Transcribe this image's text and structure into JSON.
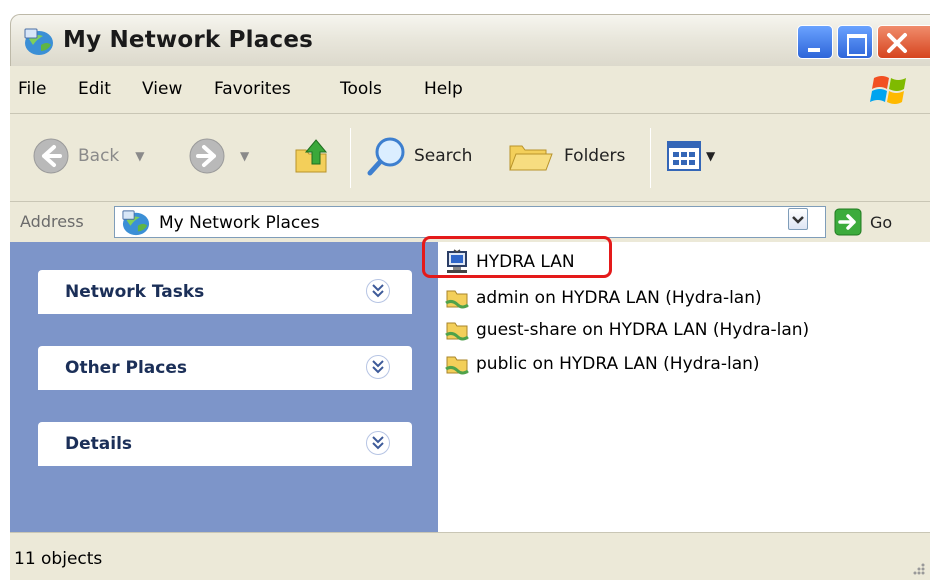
{
  "window": {
    "title": "My Network Places",
    "title_icon": "network-places-icon"
  },
  "menu": [
    "File",
    "Edit",
    "View",
    "Favorites",
    "Tools",
    "Help"
  ],
  "toolbar": {
    "back_label": "Back",
    "search_label": "Search",
    "folders_label": "Folders"
  },
  "address": {
    "label": "Address",
    "value": "My Network Places",
    "go_label": "Go"
  },
  "tasks": [
    {
      "title": "Network Tasks"
    },
    {
      "title": "Other Places"
    },
    {
      "title": "Details"
    }
  ],
  "items": [
    {
      "label": "HYDRA LAN",
      "icon": "network-computer-icon",
      "highlighted": true
    },
    {
      "label": "admin on HYDRA LAN (Hydra-lan)",
      "icon": "network-share-icon"
    },
    {
      "label": "guest-share on HYDRA LAN (Hydra-lan)",
      "icon": "network-share-icon"
    },
    {
      "label": "public on HYDRA LAN (Hydra-lan)",
      "icon": "network-share-icon"
    }
  ],
  "status": {
    "objects": "11 objects"
  },
  "colors": {
    "task_pane_bg": "#7d95c9",
    "task_title": "#1b2f58",
    "highlight_border": "#e41a1a"
  }
}
